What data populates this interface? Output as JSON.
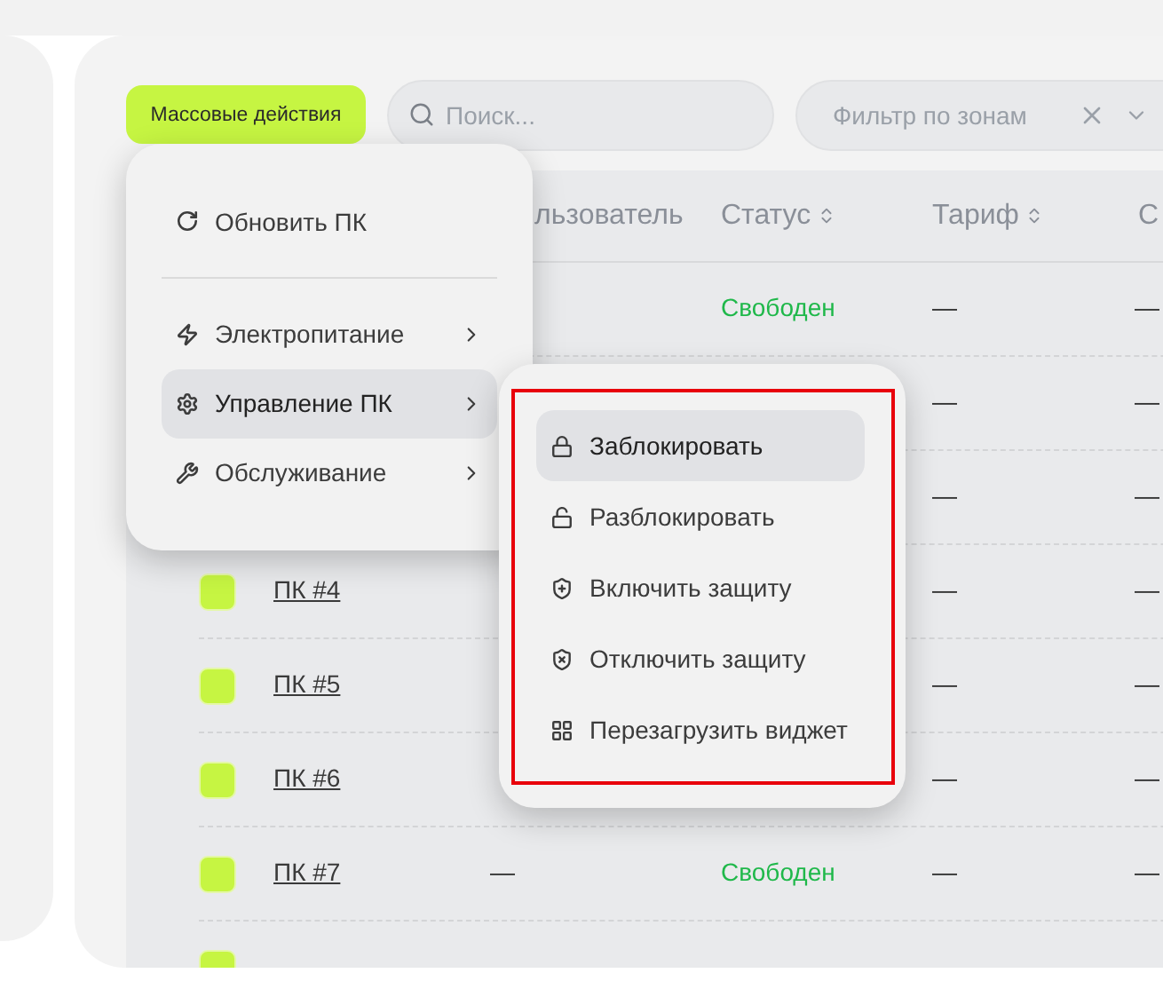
{
  "toolbar": {
    "bulk_button": "Массовые действия",
    "search": {
      "placeholder": "Поиск..."
    },
    "zone_filter": {
      "placeholder": "Фильтр по зонам"
    }
  },
  "table": {
    "columns": [
      {
        "label": "льзователь",
        "sortable": false
      },
      {
        "label": "Статус",
        "sortable": true
      },
      {
        "label": "Тариф",
        "sortable": true
      },
      {
        "label": "С"
      }
    ],
    "rows": [
      {
        "status": "Свободен",
        "tariff": "—",
        "column_5": "—"
      },
      {
        "tariff": "—",
        "column_5": "—"
      },
      {
        "tariff": "—",
        "column_5": "—"
      },
      {
        "checked": true,
        "name": "ПК #4",
        "tariff": "—",
        "column_5": "—"
      },
      {
        "checked": true,
        "name": "ПК #5",
        "tariff": "—",
        "column_5": "—"
      },
      {
        "checked": true,
        "name": "ПК #6",
        "tariff": "—",
        "column_5": "—"
      },
      {
        "checked": true,
        "name": "ПК #7",
        "user": "—",
        "status": "Свободен",
        "tariff": "—",
        "column_5": "—"
      },
      {
        "checked": true
      }
    ]
  },
  "actions_menu": {
    "items": [
      {
        "kind": "action",
        "label": "Обновить ПК"
      },
      {
        "kind": "divider"
      },
      {
        "kind": "submenu",
        "label": "Электропитание",
        "selected": false
      },
      {
        "kind": "submenu",
        "label": "Управление ПК",
        "selected": true
      },
      {
        "kind": "submenu",
        "label": "Обслуживание",
        "selected": false
      }
    ]
  },
  "pc_submenu": {
    "highlighted": true,
    "items": [
      {
        "label": "Заблокировать",
        "selected": true
      },
      {
        "label": "Разблокировать",
        "selected": false
      },
      {
        "label": "Включить защиту",
        "selected": false
      },
      {
        "label": "Отключить защиту",
        "selected": false
      },
      {
        "label": "Перезагрузить виджет",
        "selected": false
      }
    ]
  }
}
